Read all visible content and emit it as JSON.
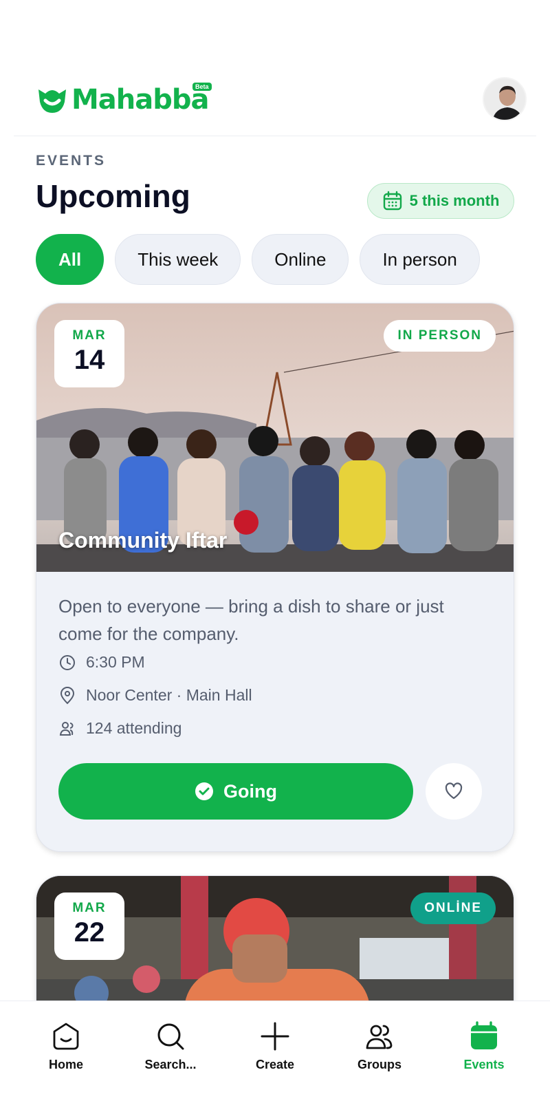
{
  "app": {
    "name": "Mahabba",
    "badge": "Beta"
  },
  "section": {
    "eyebrow": "EVENTS",
    "title": "Upcoming",
    "month_pill": "5 this month"
  },
  "filters": [
    {
      "label": "All",
      "active": true
    },
    {
      "label": "This week",
      "active": false
    },
    {
      "label": "Online",
      "active": false
    },
    {
      "label": "In person",
      "active": false
    }
  ],
  "events": [
    {
      "month": "MAR",
      "day": "14",
      "type": "IN PERSON",
      "title": "Community Iftar",
      "description": "Open to everyone — bring a dish to share or just come for the company.",
      "time": "6:30 PM",
      "location": "Noor Center · Main Hall",
      "attending": "124 attending",
      "action": "Going"
    },
    {
      "month": "MAR",
      "day": "22",
      "type": "ONLİNE"
    }
  ],
  "nav": [
    {
      "label": "Home",
      "icon": "home-icon"
    },
    {
      "label": "Search...",
      "icon": "search-icon"
    },
    {
      "label": "Create",
      "icon": "plus-icon"
    },
    {
      "label": "Groups",
      "icon": "groups-icon"
    },
    {
      "label": "Events",
      "icon": "calendar-icon",
      "active": true
    }
  ],
  "colors": {
    "brand": "#12b24c",
    "online_badge": "#10a08a",
    "card_bg": "#eff2f8"
  }
}
